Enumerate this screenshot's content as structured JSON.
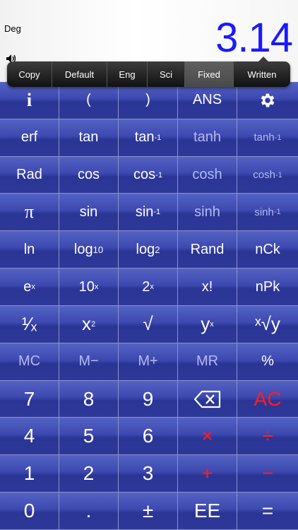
{
  "display": {
    "mode": "Deg",
    "value": "3.14"
  },
  "popup_menu": {
    "items": [
      "Copy",
      "Default",
      "Eng",
      "Sci",
      "Fixed",
      "Written"
    ],
    "selected": "Fixed"
  },
  "keypad": {
    "row1": [
      "i",
      "(",
      ")",
      "ANS",
      "settings"
    ],
    "row2": [
      "erf",
      "tan",
      "tan",
      "-1",
      "tanh",
      "tanh",
      "-1"
    ],
    "row3": [
      "Rad",
      "cos",
      "cos",
      "-1",
      "cosh",
      "cosh",
      "-1"
    ],
    "row4": [
      "π",
      "sin",
      "sin",
      "-1",
      "sinh",
      "sinh",
      "-1"
    ],
    "row5": [
      "ln",
      "log",
      "10",
      "log",
      "2",
      "Rand",
      "nCk"
    ],
    "row6": [
      "e",
      "x",
      "10",
      "x",
      "2",
      "x",
      "x!",
      "nPk"
    ],
    "row7": [
      "¹⁄ₓ",
      "x",
      "2",
      "√",
      "y",
      "x",
      "ˣ√y"
    ],
    "row8": [
      "MC",
      "M−",
      "M+",
      "MR",
      "%"
    ],
    "row9": [
      "7",
      "8",
      "9",
      "backspace",
      "AC"
    ],
    "row10": [
      "4",
      "5",
      "6",
      "×",
      "÷"
    ],
    "row11": [
      "1",
      "2",
      "3",
      "+",
      "−"
    ],
    "row12": [
      "0",
      ".",
      "±",
      "EE",
      "="
    ]
  },
  "colors": {
    "display_value": "#1a1aff",
    "key_blue": "#3d49b0",
    "operator_red": "#ff1e1e"
  }
}
